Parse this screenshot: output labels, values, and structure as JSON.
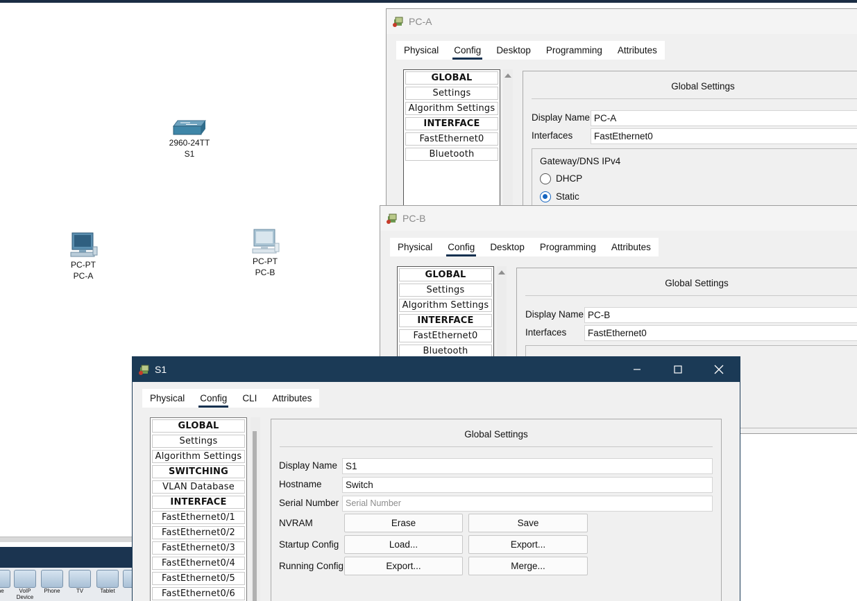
{
  "workspace": {
    "devices": [
      {
        "model": "2960-24TT",
        "name": "S1"
      },
      {
        "model": "PC-PT",
        "name": "PC-A"
      },
      {
        "model": "PC-PT",
        "name": "PC-B"
      }
    ],
    "toolbar_items": [
      "one",
      "VoIP Device",
      "Phone",
      "TV",
      "Tablet"
    ]
  },
  "pc_a": {
    "title": "PC-A",
    "tabs": [
      "Physical",
      "Config",
      "Desktop",
      "Programming",
      "Attributes"
    ],
    "active_tab": "Config",
    "left_list": [
      "GLOBAL",
      "Settings",
      "Algorithm Settings",
      "INTERFACE",
      "FastEthernet0",
      "Bluetooth"
    ],
    "heading": "Global Settings",
    "display_name_label": "Display Name",
    "display_name_value": "PC-A",
    "interfaces_label": "Interfaces",
    "interfaces_value": "FastEthernet0",
    "gateway_label": "Gateway/DNS IPv4",
    "dhcp_label": "DHCP",
    "static_label": "Static",
    "selected_mode": "Static"
  },
  "pc_b": {
    "title": "PC-B",
    "tabs": [
      "Physical",
      "Config",
      "Desktop",
      "Programming",
      "Attributes"
    ],
    "active_tab": "Config",
    "left_list": [
      "GLOBAL",
      "Settings",
      "Algorithm Settings",
      "INTERFACE",
      "FastEthernet0",
      "Bluetooth"
    ],
    "heading": "Global Settings",
    "display_name_label": "Display Name",
    "display_name_value": "PC-B",
    "interfaces_label": "Interfaces",
    "interfaces_value": "FastEthernet0"
  },
  "s1": {
    "title": "S1",
    "tabs": [
      "Physical",
      "Config",
      "CLI",
      "Attributes"
    ],
    "active_tab": "Config",
    "left_list": [
      "GLOBAL",
      "Settings",
      "Algorithm Settings",
      "SWITCHING",
      "VLAN Database",
      "INTERFACE",
      "FastEthernet0/1",
      "FastEthernet0/2",
      "FastEthernet0/3",
      "FastEthernet0/4",
      "FastEthernet0/5",
      "FastEthernet0/6"
    ],
    "heading": "Global Settings",
    "display_name_label": "Display Name",
    "display_name_value": "S1",
    "hostname_label": "Hostname",
    "hostname_value": "Switch",
    "serial_label": "Serial Number",
    "serial_placeholder": "Serial Number",
    "nvram_label": "NVRAM",
    "erase_label": "Erase",
    "save_label": "Save",
    "startup_label": "Startup Config",
    "load_label": "Load...",
    "startup_export_label": "Export...",
    "running_label": "Running Config",
    "running_export_label": "Export...",
    "merge_label": "Merge..."
  }
}
